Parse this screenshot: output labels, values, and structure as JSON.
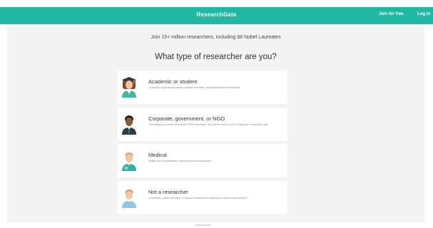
{
  "header": {
    "brand": "ResearchGate",
    "join_label": "Join for free",
    "login_label": "Log in",
    "bar_color": "#1fb8a4"
  },
  "main": {
    "tagline": "Join 15+ million researchers, including 68 Nobel Laureates",
    "question": "What type of researcher are you?",
    "options": [
      {
        "title": "Academic or student",
        "description": "University students and faculty, institute members, and independent researchers",
        "icon": "academic-avatar-icon"
      },
      {
        "title": "Corporate, government, or NGO",
        "description": "Technology or product developers, R&D specialists, and government or NGO employees in scientific roles",
        "icon": "corporate-avatar-icon"
      },
      {
        "title": "Medical",
        "description": "Health care professionals, including clinical researchers",
        "icon": "medical-avatar-icon"
      },
      {
        "title": "Not a researcher",
        "description": "Journalists, citizen scientists, or anyone interested in reading and discovering research",
        "icon": "non-researcher-avatar-icon"
      }
    ]
  }
}
